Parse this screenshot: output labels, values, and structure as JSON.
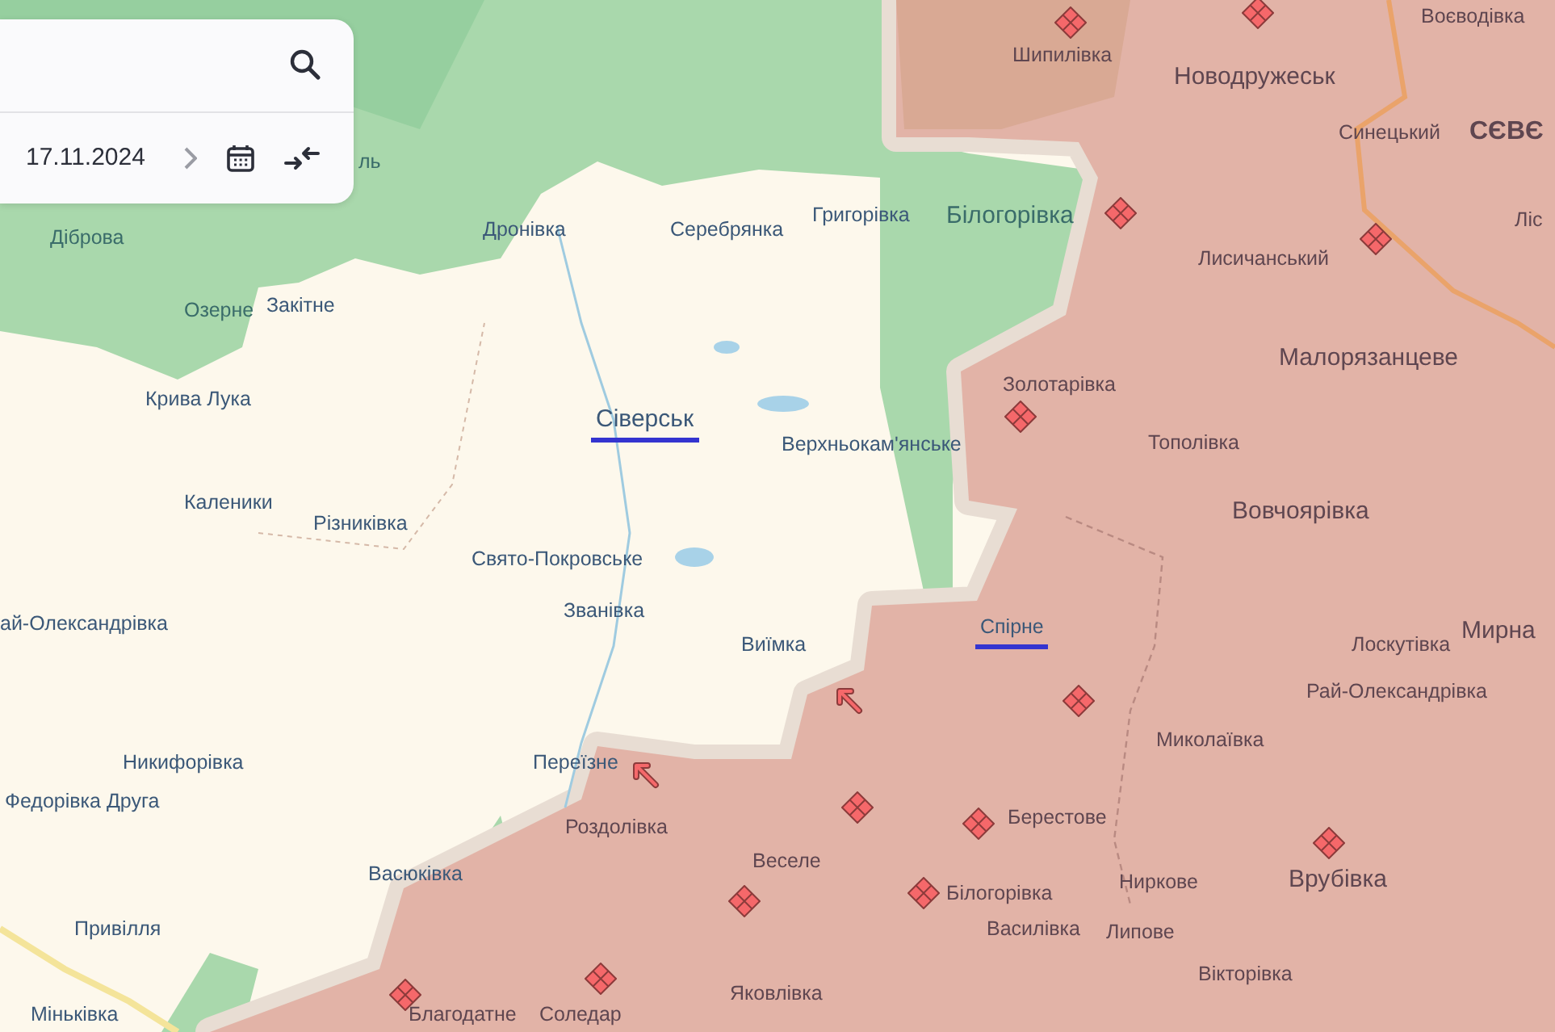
{
  "panel": {
    "date": "17.11.2024"
  },
  "map": {
    "labels": [
      {
        "text": "Воєводівка",
        "kind": "village",
        "highlighted": false
      },
      {
        "text": "Шипилівка",
        "kind": "village",
        "highlighted": false
      },
      {
        "text": "Новодружеськ",
        "kind": "town",
        "highlighted": false
      },
      {
        "text": "Синецький",
        "kind": "village",
        "highlighted": false
      },
      {
        "text": "СЄВЄ",
        "kind": "city",
        "highlighted": false
      },
      {
        "text": "ль",
        "kind": "village",
        "highlighted": false
      },
      {
        "text": "Григорівка",
        "kind": "village",
        "highlighted": false
      },
      {
        "text": "Білогорівка",
        "kind": "town",
        "highlighted": false
      },
      {
        "text": "Ліс",
        "kind": "village",
        "highlighted": false
      },
      {
        "text": "Дронівка",
        "kind": "village",
        "highlighted": false
      },
      {
        "text": "Серебрянка",
        "kind": "village",
        "highlighted": false
      },
      {
        "text": "Діброва",
        "kind": "village",
        "highlighted": false
      },
      {
        "text": "Лисичанський",
        "kind": "village",
        "highlighted": false
      },
      {
        "text": "Закітне",
        "kind": "village",
        "highlighted": false
      },
      {
        "text": "Озерне",
        "kind": "village",
        "highlighted": false
      },
      {
        "text": "Малорязанцеве",
        "kind": "town",
        "highlighted": false
      },
      {
        "text": "Золотарівка",
        "kind": "village",
        "highlighted": false
      },
      {
        "text": "Крива Лука",
        "kind": "village",
        "highlighted": false
      },
      {
        "text": "Сіверськ",
        "kind": "town",
        "highlighted": true
      },
      {
        "text": "Тополівка",
        "kind": "village",
        "highlighted": false
      },
      {
        "text": "Верхньокам'янське",
        "kind": "village",
        "highlighted": false
      },
      {
        "text": "Каленики",
        "kind": "village",
        "highlighted": false
      },
      {
        "text": "Вовчоярівка",
        "kind": "town",
        "highlighted": false
      },
      {
        "text": "Різниківка",
        "kind": "village",
        "highlighted": false
      },
      {
        "text": "Свято-Покровське",
        "kind": "village",
        "highlighted": false
      },
      {
        "text": "Званівка",
        "kind": "village",
        "highlighted": false
      },
      {
        "text": "ай-Олександрівка",
        "kind": "village",
        "highlighted": false
      },
      {
        "text": "Спірне",
        "kind": "village",
        "highlighted": true
      },
      {
        "text": "Мирна",
        "kind": "town",
        "highlighted": false
      },
      {
        "text": "Виїмка",
        "kind": "village",
        "highlighted": false
      },
      {
        "text": "Лоскутівка",
        "kind": "village",
        "highlighted": false
      },
      {
        "text": "Рай-Олександрівка",
        "kind": "village",
        "highlighted": false
      },
      {
        "text": "Миколаївка",
        "kind": "village",
        "highlighted": false
      },
      {
        "text": "Никифорівка",
        "kind": "village",
        "highlighted": false
      },
      {
        "text": "Переїзне",
        "kind": "village",
        "highlighted": false
      },
      {
        "text": "Федорівка Друга",
        "kind": "village",
        "highlighted": false
      },
      {
        "text": "Берестове",
        "kind": "village",
        "highlighted": false
      },
      {
        "text": "Роздолівка",
        "kind": "village",
        "highlighted": false
      },
      {
        "text": "Веселе",
        "kind": "village",
        "highlighted": false
      },
      {
        "text": "Васюківка",
        "kind": "village",
        "highlighted": false
      },
      {
        "text": "Ниркове",
        "kind": "village",
        "highlighted": false
      },
      {
        "text": "Врубівка",
        "kind": "town",
        "highlighted": false
      },
      {
        "text": "Білогорівка",
        "kind": "village",
        "highlighted": false
      },
      {
        "text": "Привілля",
        "kind": "village",
        "highlighted": false
      },
      {
        "text": "Василівка",
        "kind": "village",
        "highlighted": false
      },
      {
        "text": "Липове",
        "kind": "village",
        "highlighted": false
      },
      {
        "text": "Вікторівка",
        "kind": "village",
        "highlighted": false
      },
      {
        "text": "Яковлівка",
        "kind": "village",
        "highlighted": false
      },
      {
        "text": "Міньківка",
        "kind": "village",
        "highlighted": false
      },
      {
        "text": "Благодатне",
        "kind": "village",
        "highlighted": false
      },
      {
        "text": "Соледар",
        "kind": "village",
        "highlighted": false
      }
    ]
  }
}
